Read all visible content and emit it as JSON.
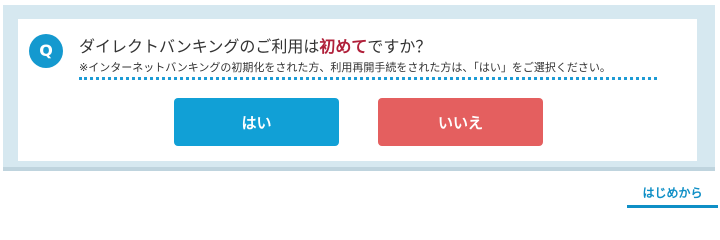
{
  "dialog": {
    "badge": "Q",
    "question_prefix": "ダイレクトバンキングのご利用は",
    "question_highlight": "初めて",
    "question_suffix": "ですか？",
    "note": "※インターネットバンキングの初期化をされた方、利用再開手続をされた方は、「はい」をご選択ください。",
    "yes_label": "はい",
    "no_label": "いいえ"
  },
  "footer": {
    "start_label": "はじめから"
  },
  "colors": {
    "accent": "#1499cf",
    "yes_button": "#11a0d6",
    "no_button": "#e45f5f",
    "highlight_text": "#b0203a",
    "frame": "#d6e8f0"
  }
}
